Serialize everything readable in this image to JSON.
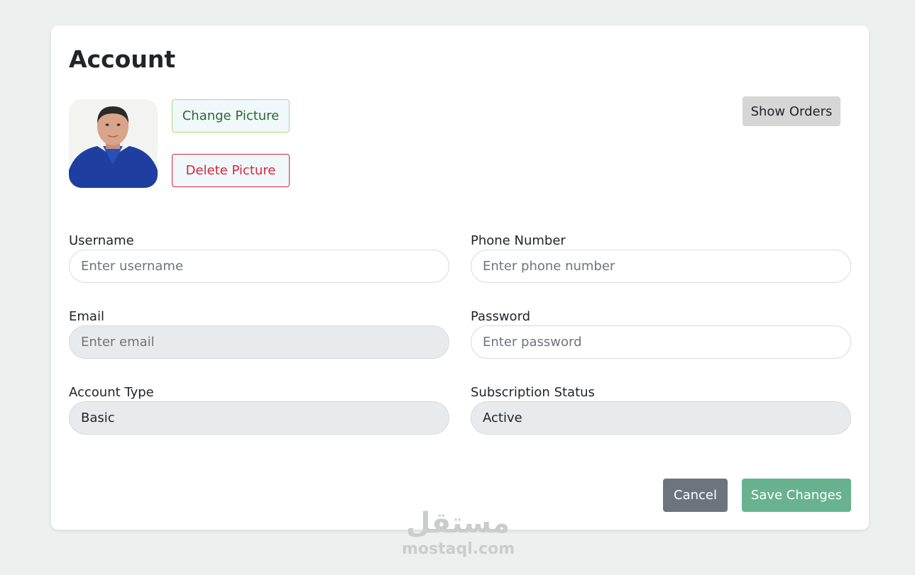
{
  "page": {
    "title": "Account"
  },
  "profile": {
    "change_picture_label": "Change Picture",
    "delete_picture_label": "Delete Picture",
    "show_orders_label": "Show Orders"
  },
  "form": {
    "username": {
      "label": "Username",
      "placeholder": "Enter username",
      "value": ""
    },
    "phone": {
      "label": "Phone Number",
      "placeholder": "Enter phone number",
      "value": ""
    },
    "email": {
      "label": "Email",
      "placeholder": "Enter email",
      "value": ""
    },
    "password": {
      "label": "Password",
      "placeholder": "Enter password",
      "value": ""
    },
    "account_type": {
      "label": "Account Type",
      "value": "Basic"
    },
    "subscription_status": {
      "label": "Subscription Status",
      "value": "Active"
    }
  },
  "actions": {
    "cancel_label": "Cancel",
    "save_label": "Save Changes"
  },
  "watermark": {
    "arabic": "مستقل",
    "latin": "mostaql.com"
  },
  "colors": {
    "background": "#ecf0ee",
    "card": "#ffffff",
    "change_border": "#a6e07a",
    "delete_red": "#d9263a",
    "cancel_gray": "#6c757d",
    "save_green": "#68b28f",
    "disabled_input": "#e8ebee"
  }
}
